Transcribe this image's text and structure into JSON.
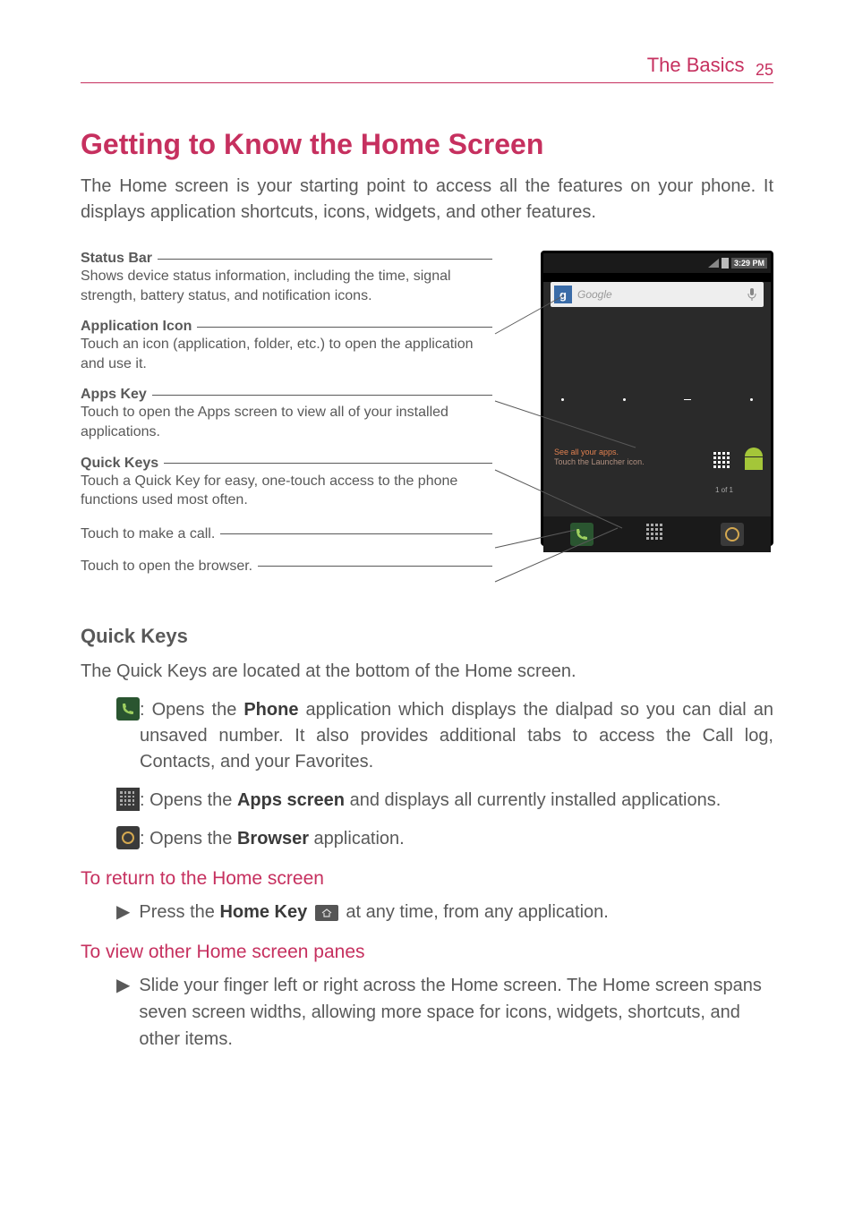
{
  "header": {
    "section": "The Basics",
    "page": "25"
  },
  "mainHeading": "Getting to Know the Home Screen",
  "intro": "The Home screen is your starting point to access all the features on your phone. It displays application shortcuts, icons, widgets, and other features.",
  "callouts": {
    "statusBar": {
      "title": "Status Bar",
      "desc": "Shows device status information, including the time, signal strength, battery status, and notification icons."
    },
    "appIcon": {
      "title": "Application Icon",
      "desc": "Touch an icon (application, folder, etc.) to open the application and use it."
    },
    "appsKey": {
      "title": "Apps Key",
      "desc": "Touch to open the Apps screen to view all of your installed applications."
    },
    "quickKeys": {
      "title": "Quick Keys",
      "desc": "Touch a Quick Key for easy, one-touch access to the phone functions used most often."
    },
    "call": "Touch to make a call.",
    "browser": "Touch to open the browser."
  },
  "phone": {
    "time": "3:29 PM",
    "searchPlaceholder": "Google",
    "searchIcon": "g",
    "hint1": "See all your apps.",
    "hint2": "Touch the Launcher icon.",
    "pager": "1 of 1"
  },
  "quickKeysSection": {
    "heading": "Quick Keys",
    "intro": "The Quick Keys are located at the bottom of the Home screen.",
    "phone": {
      "t1": ": Opens the ",
      "b": "Phone",
      "t2": " application which displays the dialpad so you can dial an unsaved number. It also provides additional tabs to access the Call log, Contacts, and your Favorites."
    },
    "apps": {
      "t1": ": Opens the ",
      "b": "Apps screen",
      "t2": " and displays all currently installed applications."
    },
    "browser": {
      "t1": ": Opens the ",
      "b": "Browser",
      "t2": " application."
    }
  },
  "returnHome": {
    "heading": "To return to the Home screen",
    "t1": "Press the ",
    "b": "Home Key",
    "t2": " at any time, from any application."
  },
  "otherPanes": {
    "heading": "To view other Home screen panes",
    "text": "Slide your finger left or right across the Home screen. The Home screen spans seven screen widths, allowing more space for icons, widgets, shortcuts, and other items."
  }
}
